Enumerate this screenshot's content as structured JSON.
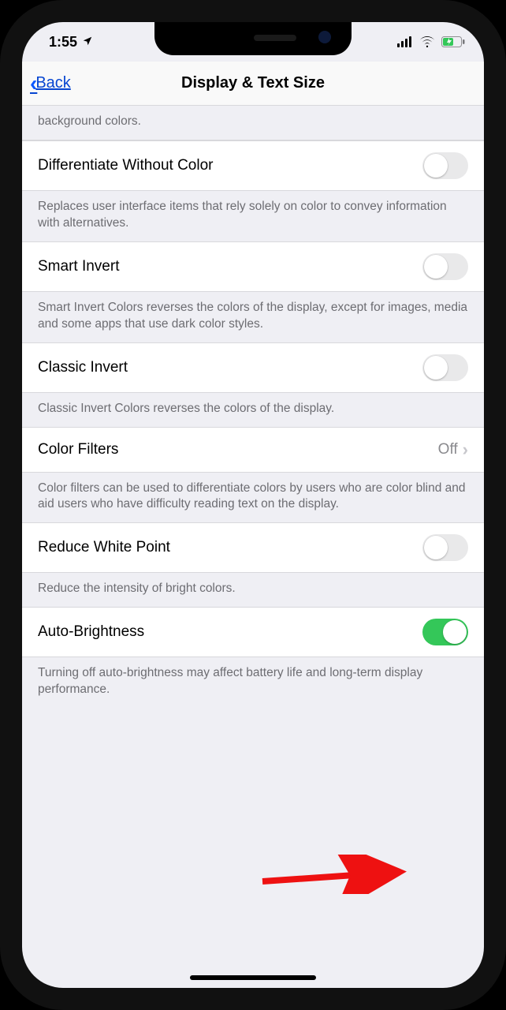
{
  "status": {
    "time": "1:55",
    "location_icon": "location-arrow"
  },
  "nav": {
    "back": "Back",
    "title": "Display & Text Size"
  },
  "partial_footer_top": "background colors.",
  "rows": {
    "diff_no_color": {
      "label": "Differentiate Without Color",
      "on": false,
      "footer": "Replaces user interface items that rely solely on color to convey information with alternatives."
    },
    "smart_invert": {
      "label": "Smart Invert",
      "on": false,
      "footer": "Smart Invert Colors reverses the colors of the display, except for images, media and some apps that use dark color styles."
    },
    "classic_invert": {
      "label": "Classic Invert",
      "on": false,
      "footer": "Classic Invert Colors reverses the colors of the display."
    },
    "color_filters": {
      "label": "Color Filters",
      "value": "Off",
      "footer": "Color filters can be used to differentiate colors by users who are color blind and aid users who have difficulty reading text on the display."
    },
    "reduce_white_point": {
      "label": "Reduce White Point",
      "on": false,
      "footer": "Reduce the intensity of bright colors."
    },
    "auto_brightness": {
      "label": "Auto-Brightness",
      "on": true,
      "footer": "Turning off auto-brightness may affect battery life and long-term display performance."
    }
  }
}
